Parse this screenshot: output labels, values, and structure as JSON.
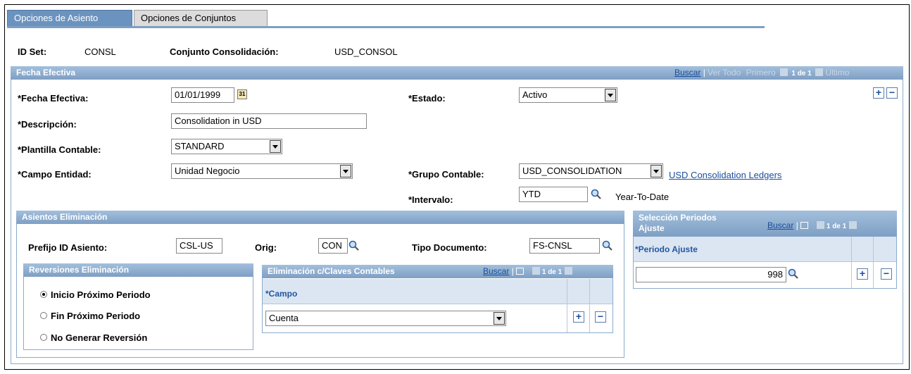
{
  "tabs": {
    "active": "Opciones de Asiento",
    "inactive": "Opciones de Conjuntos"
  },
  "header": {
    "idset_label": "ID Set:",
    "idset_value": "CONSL",
    "conjunto_label": "Conjunto Consolidación:",
    "conjunto_value": "USD_CONSOL"
  },
  "fecha_panel": {
    "title": "Fecha Efectiva",
    "nav": {
      "buscar": "Buscar",
      "sep": "|",
      "ver_todo": "Ver Todo",
      "primero": "Primero",
      "count": "1 de 1",
      "ultimo": "Último"
    },
    "fecha_label": "*Fecha Efectiva:",
    "fecha_value": "01/01/1999",
    "estado_label": "*Estado:",
    "estado_value": "Activo",
    "descripcion_label": "*Descripción:",
    "descripcion_value": "Consolidation in USD",
    "plantilla_label": "*Plantilla Contable:",
    "plantilla_value": "STANDARD",
    "campo_entidad_label": "*Campo Entidad:",
    "campo_entidad_value": "Unidad Negocio",
    "grupo_label": "*Grupo Contable:",
    "grupo_value": "USD_CONSOLIDATION",
    "grupo_link": "USD Consolidation Ledgers",
    "intervalo_label": "*Intervalo:",
    "intervalo_value": "YTD",
    "intervalo_desc": "Year-To-Date"
  },
  "asientos": {
    "title": "Asientos Eliminación",
    "prefijo_label": "Prefijo ID Asiento:",
    "prefijo_value": "CSL-US",
    "orig_label": "Orig:",
    "orig_value": "CON",
    "tipo_label": "Tipo Documento:",
    "tipo_value": "FS-CNSL"
  },
  "reversiones": {
    "title": "Reversiones Eliminación",
    "options": [
      "Inicio Próximo Periodo",
      "Fin Próximo Periodo",
      "No Generar Reversión"
    ],
    "selected_index": 0
  },
  "claves": {
    "title": "Eliminación c/Claves Contables",
    "buscar": "Buscar",
    "count": "1 de 1",
    "col": "*Campo",
    "value": "Cuenta"
  },
  "periodos": {
    "title_line1": "Selección Periodos",
    "title_line2": "Ajuste",
    "buscar": "Buscar",
    "count": "1 de 1",
    "col": "*Periodo Ajuste",
    "value": "998"
  },
  "colors": {
    "header": "#8aaccd",
    "link": "#1b4e9b",
    "tab_active": "#6b93bf"
  }
}
